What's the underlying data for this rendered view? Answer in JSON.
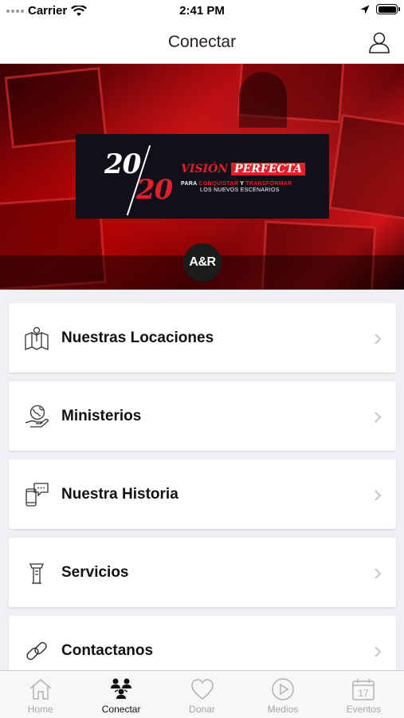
{
  "status_bar": {
    "carrier": "Carrier",
    "time": "2:41 PM",
    "icons": [
      "signal-dots-icon",
      "wifi-icon",
      "location-arrow-icon",
      "battery-icon"
    ]
  },
  "nav": {
    "title": "Conectar",
    "profile_icon": "user-icon"
  },
  "banner": {
    "number_top": "20",
    "number_bottom": "20",
    "vision": "VISIÓN",
    "perfecta": "PERFECTA",
    "tagline_para": "PARA",
    "tagline_conquistar": "CONQUISTAR",
    "tagline_y": "Y",
    "tagline_transformar": "TRANSFORMAR",
    "tagline_line2": "LOS NUEVOS ESCENARIOS",
    "logo": "A&R",
    "accent_color": "#e3202a"
  },
  "menu": {
    "items": [
      {
        "label": "Nuestras Locaciones",
        "icon": "map-pin-icon"
      },
      {
        "label": "Ministerios",
        "icon": "hand-globe-icon"
      },
      {
        "label": "Nuestra Historia",
        "icon": "phone-chat-icon"
      },
      {
        "label": "Servicios",
        "icon": "lectern-icon"
      },
      {
        "label": "Contactanos",
        "icon": "link-icon"
      }
    ]
  },
  "tabs": [
    {
      "label": "Home",
      "icon": "home-icon",
      "active": false
    },
    {
      "label": "Conectar",
      "icon": "people-icon",
      "active": true
    },
    {
      "label": "Donar",
      "icon": "heart-icon",
      "active": false
    },
    {
      "label": "Medios",
      "icon": "play-circle-icon",
      "active": false
    },
    {
      "label": "Eventos",
      "icon": "calendar-icon",
      "active": false,
      "badge": "17"
    }
  ]
}
